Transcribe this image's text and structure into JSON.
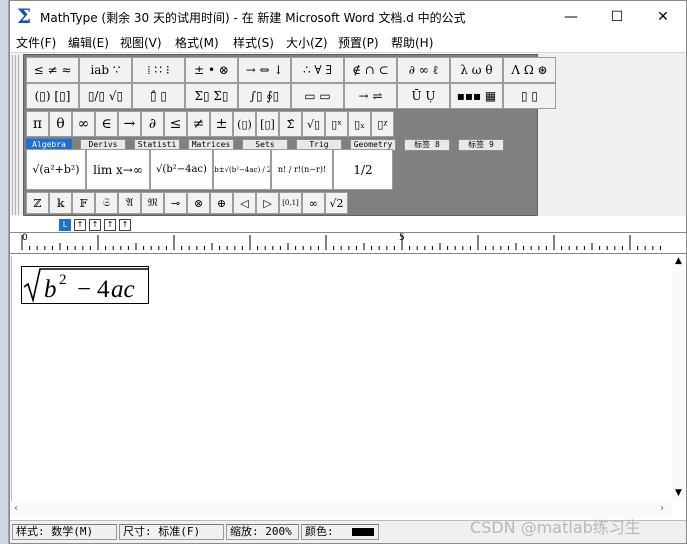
{
  "window": {
    "title": "MathType (剩余 30 天的试用时间) - 在 新建 Microsoft Word 文档.d 中的公式",
    "minimize": "—",
    "maximize": "☐",
    "close": "✕"
  },
  "menu": [
    "文件(F)",
    "编辑(E)",
    "视图(V)",
    "格式(M)",
    "样式(S)",
    "大小(Z)",
    "预置(P)",
    "帮助(H)"
  ],
  "symbol_rows": [
    [
      "≤ ≠ ≈",
      "ⅰab ∵",
      "⁞ ∷ ⁝",
      "± • ⊗",
      "→ ⇔ ↓",
      "∴ ∀ ∃",
      "∉ ∩ ⊂",
      "∂ ∞ ℓ",
      "λ ω θ",
      "Λ Ω ⊛"
    ],
    [
      "(▯) [▯]",
      "▯/▯ √▯",
      "▯̂ ▯",
      "Σ▯ Σ▯",
      "∫▯ ∮▯",
      "▭ ▭",
      "→ ⇌",
      "Ū Ụ",
      "▪▪▪ ▦",
      "▯ ▯"
    ]
  ],
  "quick_symbols": [
    "π",
    "θ",
    "∞",
    "∈",
    "→",
    "∂",
    "≤",
    "≠",
    "±",
    "(▯)",
    "[▯]",
    "Σ̂",
    "√▯",
    "▯ˣ",
    "▯ₓ",
    "▯ᵡ"
  ],
  "tabs": [
    "Algebra",
    "Derivs",
    "Statisti",
    "Matrices",
    "Sets",
    "Trig",
    "Geometry",
    "标签 8",
    "标签 9"
  ],
  "templates": [
    "√(a²+b²)",
    "lim x→∞",
    "√(b²−4ac)",
    "−b±√(b²−4ac) / 2a",
    "n! / r!(n−r)!",
    "1/2"
  ],
  "letters": [
    "ℤ",
    "𝕜",
    "𝔽",
    "𝔖",
    "𝔄",
    "𝔐",
    "⊸",
    "⊗",
    "⊕",
    "◁",
    "▷",
    "[0,1]",
    "∞",
    "√2"
  ],
  "size_buttons": [
    "L",
    "↑",
    "↑",
    "↑",
    "↑"
  ],
  "ruler": {
    "mark_0": "0",
    "mark_5": "5"
  },
  "equation": {
    "text": "√(b² − 4ac)"
  },
  "status": {
    "style": "样式: 数学(M)",
    "size": "尺寸: 标准(F)",
    "zoom": "缩放: 200%",
    "color": "颜色:"
  },
  "watermark": "CSDN @matlab练习生",
  "colors": {
    "accent": "#1c6fd4",
    "icon": "#1a4fb5"
  }
}
